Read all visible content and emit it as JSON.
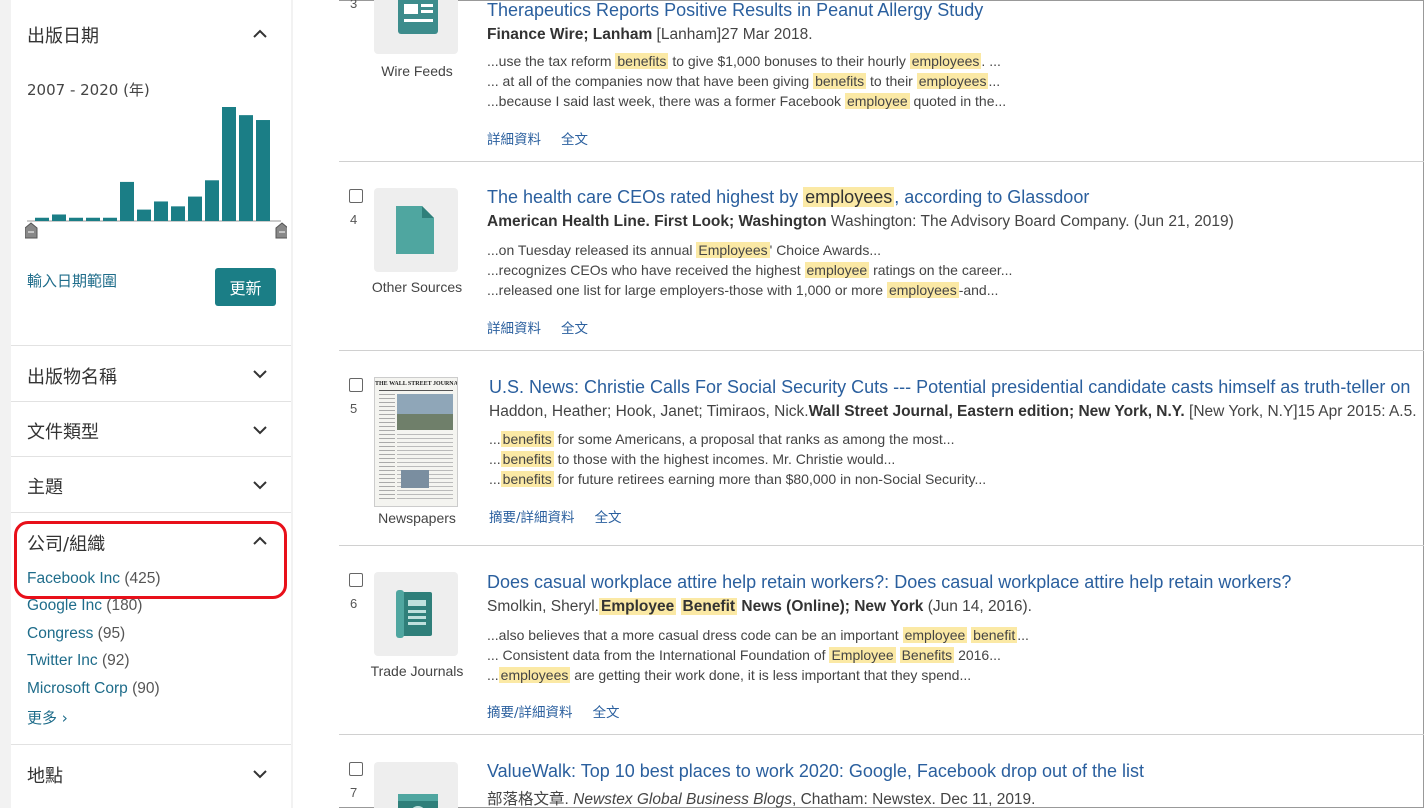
{
  "sidebar": {
    "date_section": {
      "title": "出版日期",
      "range": "2007 - 2020 (年)",
      "date_range_link": "輸入日期範圍",
      "update_button": "更新",
      "histogram": [
        2,
        4,
        2,
        2,
        2,
        24,
        7,
        12,
        9,
        15,
        25,
        70,
        65,
        62
      ]
    },
    "facets": [
      {
        "title": "出版物名稱"
      },
      {
        "title": "文件類型"
      },
      {
        "title": "主題"
      }
    ],
    "company": {
      "title": "公司/組織",
      "items": [
        {
          "name": "Facebook Inc",
          "count": "(425)"
        },
        {
          "name": "Google Inc",
          "count": "(180)"
        },
        {
          "name": "Congress",
          "count": "(95)"
        },
        {
          "name": "Twitter Inc",
          "count": "(92)"
        },
        {
          "name": "Microsoft Corp",
          "count": "(90)"
        }
      ],
      "more": "更多 ›"
    },
    "location": {
      "title": "地點"
    }
  },
  "results": [
    {
      "num": "3",
      "source": "Wire Feeds",
      "title": "Therapeutics Reports Positive Results in Peanut Allergy Study",
      "cite_bold": "Finance Wire; Lanham",
      "cite_rest": " [Lanham]27 Mar 2018.",
      "snippets": [
        [
          "...use the tax reform ",
          "benefits",
          " to give $1,000 bonuses to their hourly ",
          "employees",
          ". ..."
        ],
        [
          "... at all of the companies now that have been giving ",
          "benefits",
          " to their ",
          "employees",
          "..."
        ],
        [
          "...because I said last week, there was a former Facebook ",
          "employee",
          " quoted in the..."
        ]
      ],
      "links": [
        "詳細資料",
        "全文"
      ]
    },
    {
      "num": "4",
      "source": "Other Sources",
      "title_pre": "The health care CEOs rated highest by ",
      "title_hl": "employees",
      "title_post": ", according to Glassdoor",
      "cite_bold": "American Health Line. First Look; Washington",
      "cite_rest": "  Washington: The Advisory Board Company. (Jun 21, 2019)",
      "snippets": [
        [
          "...on Tuesday released its annual ",
          "Employees",
          "' Choice Awards..."
        ],
        [
          "...recognizes CEOs who have received the highest ",
          "employee",
          " ratings on the career..."
        ],
        [
          "...released one list for large employers-those with 1,000 or more ",
          "employees",
          "-and..."
        ]
      ],
      "links": [
        "詳細資料",
        "全文"
      ]
    },
    {
      "num": "5",
      "source": "Newspapers",
      "title": "U.S. News: Christie Calls For Social Security Cuts --- Potential presidential candidate casts himself as truth-teller on",
      "cite_plain": "Haddon, Heather; Hook, Janet; Timiraos, Nick.",
      "cite_bold": "Wall Street Journal, Eastern edition; New York, N.Y.",
      "cite_rest": " [New York, N.Y]15 Apr 2015: A.5.",
      "snippets": [
        [
          "...",
          "benefits",
          " for some Americans, a proposal that ranks as among the most..."
        ],
        [
          "...",
          "benefits",
          " to those with the highest incomes. Mr. Christie would..."
        ],
        [
          "...",
          "benefits",
          " for future retirees earning more than $80,000 in non-Social Security..."
        ]
      ],
      "links": [
        "摘要/詳細資料",
        "全文"
      ],
      "masthead": "THE WALL STREET JOURNAL."
    },
    {
      "num": "6",
      "source": "Trade Journals",
      "title": "Does casual workplace attire help retain workers?: Does casual workplace attire help retain workers?",
      "cite_plain": "Smolkin, Sheryl.",
      "cite_hl1": "Employee",
      "cite_hl2": "Benefit",
      "cite_bold": " News (Online); New York",
      "cite_rest": " (Jun 14, 2016).",
      "snippets": [
        [
          "...also believes that a more casual dress code can be an important ",
          "employee",
          " ",
          "benefit",
          "..."
        ],
        [
          "... Consistent data from the International Foundation of ",
          "Employee",
          " ",
          "Benefits",
          " 2016..."
        ],
        [
          "...",
          "employees",
          " are getting their work done, it is less important that they spend..."
        ]
      ],
      "links": [
        "摘要/詳細資料",
        "全文"
      ]
    },
    {
      "num": "7",
      "title": "ValueWalk: Top 10 best places to work 2020: Google, Facebook drop out of the list",
      "cite_plain": "部落格文章. ",
      "cite_italic": "Newstex Global Business Blogs",
      "cite_rest": ", Chatham: Newstex. Dec 11, 2019."
    }
  ]
}
